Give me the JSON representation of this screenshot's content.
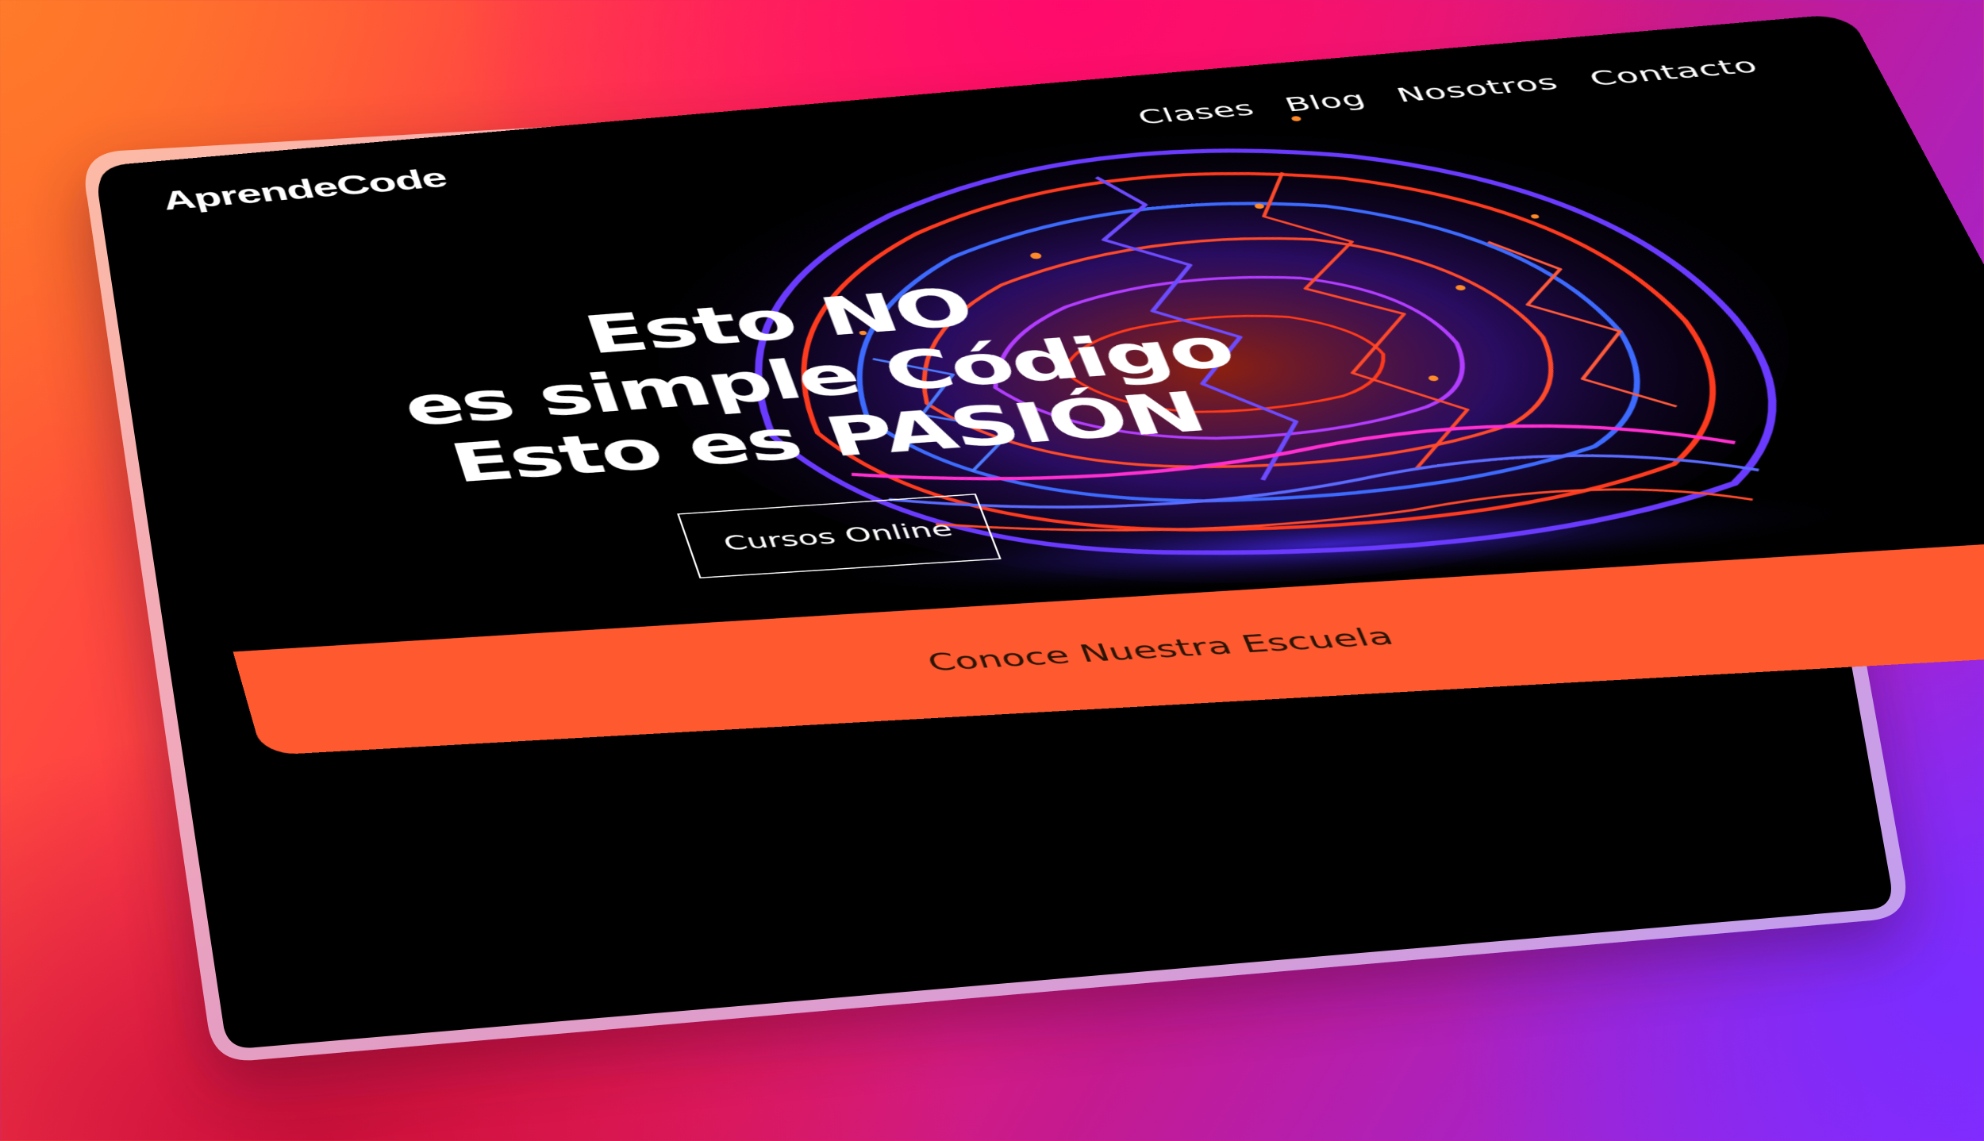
{
  "site": {
    "logo": "AprendeCode"
  },
  "nav": {
    "items": [
      {
        "label": "Clases"
      },
      {
        "label": "Blog"
      },
      {
        "label": "Nosotros"
      },
      {
        "label": "Contacto"
      }
    ]
  },
  "hero": {
    "line1": "Esto NO",
    "line2": "es simple Código",
    "line3": "Esto es PASIÓN",
    "cta_label": "Cursos Online"
  },
  "banner": {
    "label": "Conoce Nuestra Escuela"
  },
  "colors": {
    "accent": "#ff5a2f",
    "screen_bg": "#000000",
    "background_start": "#ff6a2a",
    "background_end": "#8a2bff"
  },
  "icons": {
    "hero_graphic": "brain-illustration"
  }
}
